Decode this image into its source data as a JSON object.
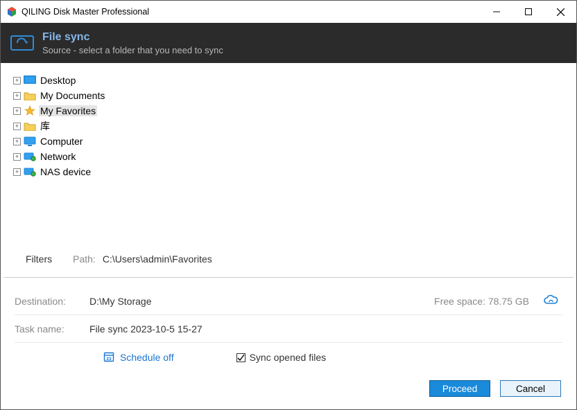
{
  "titlebar": {
    "title": "QILING Disk Master Professional"
  },
  "header": {
    "title": "File sync",
    "subtitle": "Source - select a folder that you need to sync"
  },
  "tree": {
    "items": [
      {
        "label": "Desktop",
        "icon": "desktop",
        "selected": false
      },
      {
        "label": "My Documents",
        "icon": "folder",
        "selected": false
      },
      {
        "label": "My Favorites",
        "icon": "star",
        "selected": true
      },
      {
        "label": "库",
        "icon": "folder",
        "selected": false
      },
      {
        "label": "Computer",
        "icon": "computer",
        "selected": false
      },
      {
        "label": "Network",
        "icon": "network",
        "selected": false
      },
      {
        "label": "NAS device",
        "icon": "network",
        "selected": false
      }
    ]
  },
  "pathbar": {
    "filters_label": "Filters",
    "path_label": "Path:",
    "path_value": "C:\\Users\\admin\\Favorites"
  },
  "destination": {
    "label": "Destination:",
    "value": "D:\\My Storage",
    "free_space": "Free space: 78.75 GB"
  },
  "task": {
    "label": "Task name:",
    "value": "File sync 2023-10-5 15-27"
  },
  "options": {
    "schedule_label": "Schedule off",
    "sync_opened_label": "Sync opened files",
    "sync_opened_checked": true
  },
  "footer": {
    "proceed": "Proceed",
    "cancel": "Cancel"
  }
}
